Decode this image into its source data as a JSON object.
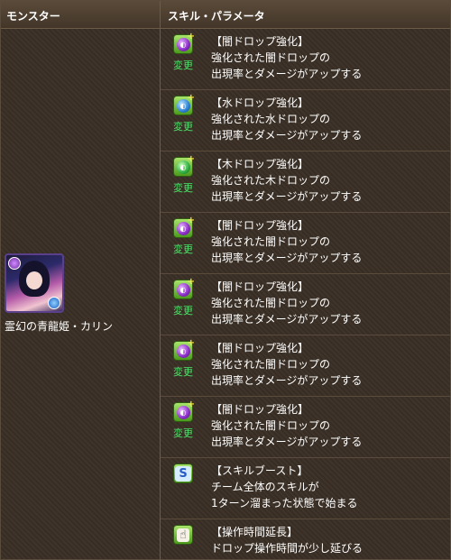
{
  "header": {
    "monster": "モンスター",
    "skill": "スキル・パラメータ"
  },
  "monster": {
    "name": "霊幻の青龍姫・カリン"
  },
  "change_label": "変更",
  "skills": [
    {
      "icon": "dark-drop-enhance-icon",
      "orb": "dark",
      "lines": [
        "【闇ドロップ強化】",
        "強化された闇ドロップの",
        "出現率とダメージがアップする"
      ]
    },
    {
      "icon": "water-drop-enhance-icon",
      "orb": "water",
      "lines": [
        "【水ドロップ強化】",
        "強化された水ドロップの",
        "出現率とダメージがアップする"
      ]
    },
    {
      "icon": "wood-drop-enhance-icon",
      "orb": "wood",
      "lines": [
        "【木ドロップ強化】",
        "強化された木ドロップの",
        "出現率とダメージがアップする"
      ]
    },
    {
      "icon": "dark-drop-enhance-icon",
      "orb": "dark",
      "lines": [
        "【闇ドロップ強化】",
        "強化された闇ドロップの",
        "出現率とダメージがアップする"
      ]
    },
    {
      "icon": "dark-drop-enhance-icon",
      "orb": "dark",
      "lines": [
        "【闇ドロップ強化】",
        "強化された闇ドロップの",
        "出現率とダメージがアップする"
      ]
    },
    {
      "icon": "dark-drop-enhance-icon",
      "orb": "dark",
      "lines": [
        "【闇ドロップ強化】",
        "強化された闇ドロップの",
        "出現率とダメージがアップする"
      ]
    },
    {
      "icon": "dark-drop-enhance-icon",
      "orb": "dark",
      "lines": [
        "【闇ドロップ強化】",
        "強化された闇ドロップの",
        "出現率とダメージがアップする"
      ]
    },
    {
      "icon": "skill-boost-icon",
      "orb": "",
      "lines": [
        "【スキルブースト】",
        "チーム全体のスキルが",
        "1ターン溜まった状態で始まる"
      ]
    },
    {
      "icon": "extend-time-icon",
      "orb": "",
      "lines": [
        "【操作時間延長】",
        "ドロップ操作時間が少し延びる"
      ]
    }
  ]
}
